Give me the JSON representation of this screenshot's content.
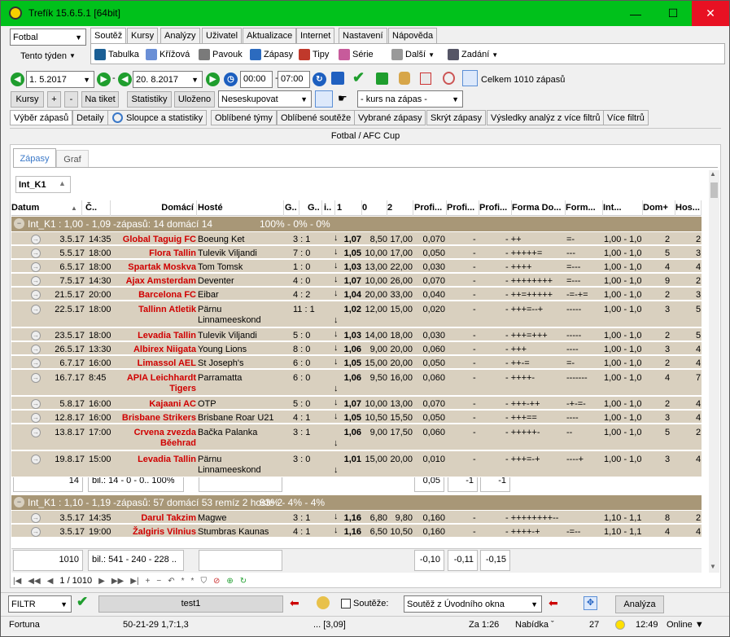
{
  "window": {
    "title": "Trefík 15.6.5.1 [64bit]",
    "min": "—",
    "max": "☐",
    "close": "✕"
  },
  "sport": "Fotbal",
  "week": "Tento týden",
  "tabs": [
    "Soutěž",
    "Kursy",
    "Analýzy",
    "Uživatel",
    "Aktualizace",
    "Internet",
    "Nastavení",
    "Nápověda"
  ],
  "toolbar": [
    "Tabulka",
    "Křížová",
    "Pavouk",
    "Zápasy",
    "Tipy",
    "Série",
    "Další",
    "Zadání"
  ],
  "dates": {
    "from": "1. 5.2017",
    "to": "20. 8.2017",
    "time_from": "00:00",
    "time_to": "07:00",
    "count": "Celkem 1010 zápasů"
  },
  "row2": {
    "kursy": "Kursy",
    "plus": "+",
    "minus": "-",
    "na_tiket": "Na tiket",
    "statistiky": "Statistiky",
    "ulozeno": "Uloženo",
    "neseskupovat": "Neseskupovat",
    "kurs": "- kurs na zápas -"
  },
  "subtabs": [
    "Výběr zápasů",
    "Detaily",
    "Sloupce a statistiky",
    "Oblíbené týmy",
    "Oblíbené soutěže",
    "Vybrané zápasy",
    "Skrýt zápasy",
    "Výsledky analýz z více filtrů",
    "Více filtrů"
  ],
  "competition": "Fotbal / AFC Cup",
  "innertabs": [
    "Zápasy",
    "Graf"
  ],
  "groupby": "Int_K1",
  "columns": [
    "Datum",
    "Č..",
    "Domácí",
    "Hosté",
    "G..",
    "G..",
    "i..",
    "1",
    "0",
    "2",
    "Profi...",
    "Profi...",
    "Profi...",
    "Forma Do...",
    "Form...",
    "Int...",
    "Dom+",
    "Hos..."
  ],
  "group1": {
    "label": "Int_K1 : 1,00 - 1,09",
    "desc": "-zápasů: 14 domácí 14",
    "pct": "100% - 0% - 0%"
  },
  "rows1": [
    [
      "3.5.17",
      "14:35",
      "Global Taguig FC",
      "Boeung Ket",
      "3 : 1",
      "1,07",
      "8,50",
      "17,00",
      "0,070",
      "-",
      "- ++",
      "=-",
      "1,00 - 1,0",
      "2",
      "2"
    ],
    [
      "5.5.17",
      "18:00",
      "Flora Tallin",
      "Tulevik Viljandi",
      "7 : 0",
      "1,05",
      "10,00",
      "17,00",
      "0,050",
      "-",
      "- +++++=",
      "---",
      "1,00 - 1,0",
      "5",
      "3"
    ],
    [
      "6.5.17",
      "18:00",
      "Spartak Moskva",
      "Tom Tomsk",
      "1 : 0",
      "1,03",
      "13,00",
      "22,00",
      "0,030",
      "-",
      "- ++++",
      "=---",
      "1,00 - 1,0",
      "4",
      "4"
    ],
    [
      "7.5.17",
      "14:30",
      "Ajax Amsterdam",
      "Deventer",
      "4 : 0",
      "1,07",
      "10,00",
      "26,00",
      "0,070",
      "-",
      "- ++++++++",
      "=---",
      "1,00 - 1,0",
      "9",
      "2"
    ],
    [
      "21.5.17",
      "20:00",
      "Barcelona FC",
      "Eibar",
      "4 : 2",
      "1,04",
      "20,00",
      "33,00",
      "0,040",
      "-",
      "- ++=+++++",
      "-=-+=",
      "1,00 - 1,0",
      "2",
      "3"
    ],
    [
      "22.5.17",
      "18:00",
      "Tallinn Atletik",
      "Pärnu Linnameeskond",
      "11 : 1",
      "1,02",
      "12,00",
      "15,00",
      "0,020",
      "-",
      "- +++=--+",
      "-----",
      "1,00 - 1,0",
      "3",
      "5"
    ],
    [
      "23.5.17",
      "18:00",
      "Levadia Tallin",
      "Tulevik Viljandi",
      "5 : 0",
      "1,03",
      "14,00",
      "18,00",
      "0,030",
      "-",
      "- +++=+++",
      "-----",
      "1,00 - 1,0",
      "2",
      "5"
    ],
    [
      "26.5.17",
      "13:30",
      "Albirex Niigata",
      "Young Lions",
      "8 : 0",
      "1,06",
      "9,00",
      "20,00",
      "0,060",
      "-",
      "- +++",
      "----",
      "1,00 - 1,0",
      "3",
      "4"
    ],
    [
      "6.7.17",
      "16:00",
      "Limassol AEL",
      "St Joseph's",
      "6 : 0",
      "1,05",
      "15,00",
      "20,00",
      "0,050",
      "-",
      "- ++-=",
      "=-",
      "1,00 - 1,0",
      "2",
      "4"
    ],
    [
      "16.7.17",
      "8:45",
      "APIA Leichhardt Tigers",
      "Parramatta",
      "6 : 0",
      "1,06",
      "9,50",
      "16,00",
      "0,060",
      "-",
      "- ++++-",
      "-------",
      "1,00 - 1,0",
      "4",
      "7"
    ],
    [
      "5.8.17",
      "16:00",
      "Kajaani AC",
      "OTP",
      "5 : 0",
      "1,07",
      "10,00",
      "13,00",
      "0,070",
      "-",
      "- +++-++",
      "-+-=-",
      "1,00 - 1,0",
      "2",
      "4"
    ],
    [
      "12.8.17",
      "16:00",
      "Brisbane Strikers",
      "Brisbane Roar U21",
      "4 : 1",
      "1,05",
      "10,50",
      "15,50",
      "0,050",
      "-",
      "- +++==",
      "----",
      "1,00 - 1,0",
      "3",
      "4"
    ],
    [
      "13.8.17",
      "17:00",
      "Crvena zvezda Běehrad",
      "Bačka Palanka",
      "3 : 1",
      "1,06",
      "9,00",
      "17,50",
      "0,060",
      "-",
      "- +++++-",
      "--",
      "1,00 - 1,0",
      "5",
      "2"
    ],
    [
      "19.8.17",
      "15:00",
      "Levadia Tallin",
      "Pärnu Linnameeskond",
      "3 : 0",
      "1,01",
      "15,00",
      "20,00",
      "0,010",
      "-",
      "- +++=-+",
      "----+",
      "1,00 - 1,0",
      "3",
      "4"
    ]
  ],
  "sum1": {
    "count": "14",
    "bil": "bil.: 14 - 0 - 0.. 100%",
    "p1": "0,05",
    "p2": "-1",
    "p3": "-1"
  },
  "group2": {
    "label": "Int_K1 : 1,10 - 1,19",
    "desc": "-zápasů: 57 domácí 53 remíz 2 hosté 2",
    "pct": "93% - 4% - 4%"
  },
  "rows2": [
    [
      "3.5.17",
      "14:35",
      "Darul Takzim",
      "Magwe",
      "3 : 1",
      "1,16",
      "6,80",
      "9,80",
      "0,160",
      "-",
      "- ++++++++--",
      "",
      "1,10 - 1,1",
      "8",
      "2"
    ],
    [
      "3.5.17",
      "19:00",
      "Žalgiris Vilnius",
      "Stumbras Kaunas",
      "4 : 1",
      "1,16",
      "6,50",
      "10,50",
      "0,160",
      "-",
      "- ++++-+",
      "-=--",
      "1,10 - 1,1",
      "4",
      "4"
    ]
  ],
  "sum2": {
    "count": "1010",
    "bil": "bil.: 541 - 240 - 228 ..",
    "p1": "-0,10",
    "p2": "-0,11",
    "p3": "-0,15"
  },
  "nav": {
    "pos": "1 / 1010"
  },
  "filter": {
    "label": "FILTR",
    "name": "test1",
    "soutez": "Soutěže:",
    "mode": "Soutěž z Úvodního okna",
    "analyza": "Analýza"
  },
  "status": {
    "db": "Fortuna",
    "score": "50-21-29  1,7:1,3",
    "odds": "... [3,09]",
    "za": "Za 1:26",
    "nabidka": "Nabídka ˇ",
    "num": "27",
    "time": "12:49",
    "online": "Online ▼"
  },
  "colors": {
    "title": "#00c11b",
    "group": "#a89777",
    "row": "#d9d0bf",
    "home": "#d00000"
  }
}
